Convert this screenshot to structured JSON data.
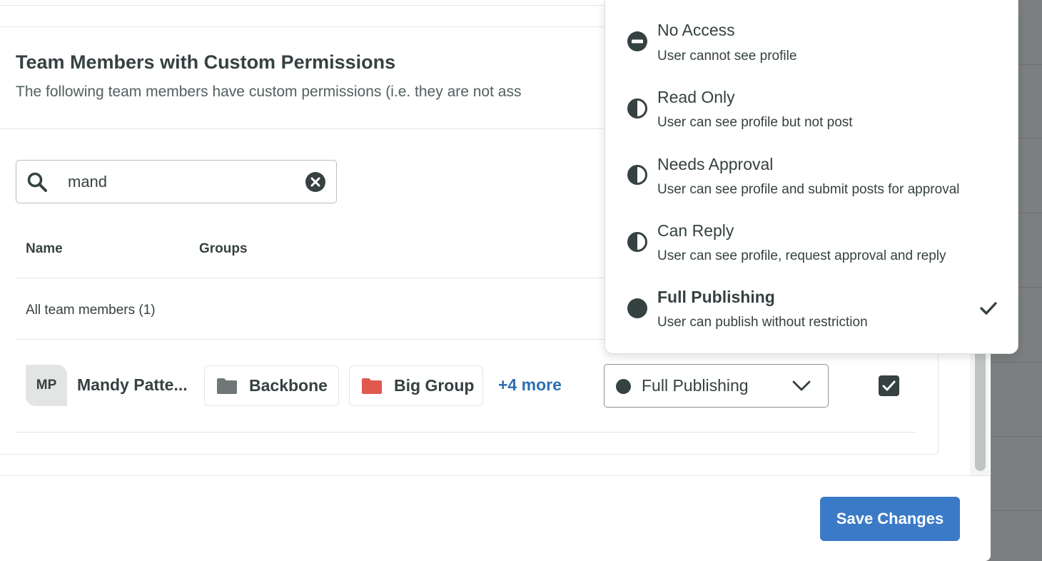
{
  "section": {
    "title": "Team Members with Custom Permissions",
    "subtitle": "The following team members have custom permissions (i.e. they are not ass"
  },
  "search": {
    "value": "mand",
    "placeholder": ""
  },
  "table": {
    "columns": [
      "Name",
      "Groups"
    ],
    "all_members_label": "All team members (1)",
    "rows": [
      {
        "avatar_initials": "MP",
        "name": "Mandy Patte...",
        "groups": [
          {
            "label": "Backbone",
            "icon": "folder-icon",
            "color": "#6f7777"
          },
          {
            "label": "Big Group",
            "icon": "folder-icon",
            "color": "#e0584e"
          }
        ],
        "more_label": "+4 more",
        "permission": "Full Publishing",
        "checked": true
      }
    ]
  },
  "permission_options": [
    {
      "title": "No Access",
      "description": "User cannot see profile",
      "icon": "no-access-icon",
      "selected": false
    },
    {
      "title": "Read Only",
      "description": "User can see profile but not post",
      "icon": "half-circle-icon",
      "selected": false
    },
    {
      "title": "Needs Approval",
      "description": "User can see profile and submit posts for approval",
      "icon": "half-circle-icon",
      "selected": false
    },
    {
      "title": "Can Reply",
      "description": "User can see profile, request approval and reply",
      "icon": "half-circle-icon",
      "selected": false
    },
    {
      "title": "Full Publishing",
      "description": "User can publish without restriction",
      "icon": "full-circle-icon",
      "selected": true
    }
  ],
  "footer": {
    "save_label": "Save Changes"
  },
  "colors": {
    "primary": "#3b7ac7",
    "text": "#364141",
    "link": "#2d6fb3",
    "danger_folder": "#e0584e",
    "neutral_folder": "#6f7777"
  }
}
